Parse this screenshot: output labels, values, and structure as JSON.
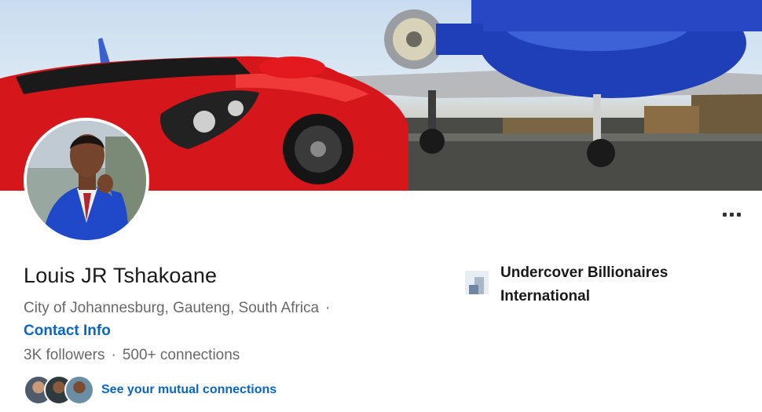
{
  "profile": {
    "name": "Louis JR Tshakoane",
    "location": "City of Johannesburg, Gauteng, South Africa",
    "location_separator": "·",
    "contact_info_label": "Contact Info",
    "followers": "3K followers",
    "stats_separator": "·",
    "connections": "500+ connections",
    "mutual_connections_label": "See your mutual connections"
  },
  "company": {
    "name": "Undercover Billionaires International"
  },
  "icons": {
    "more": "more-options-icon",
    "company_logo": "company-logo-icon"
  },
  "colors": {
    "link": "#0a66c2",
    "text_primary": "#191919",
    "text_secondary": "#666666",
    "banner_car": "#d5161a",
    "banner_jet": "#1f3fb8"
  }
}
